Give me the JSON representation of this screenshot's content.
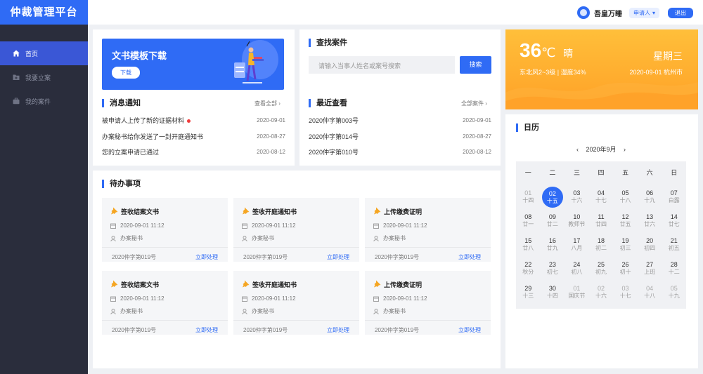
{
  "app": {
    "title": "仲裁管理平台"
  },
  "header": {
    "username": "吾皇万睡",
    "role": "申请人",
    "logout": "退出"
  },
  "sidebar": {
    "items": [
      {
        "label": "首页"
      },
      {
        "label": "我要立案"
      },
      {
        "label": "我的案件"
      }
    ]
  },
  "banner": {
    "title": "文书模板下载",
    "button": "下载"
  },
  "messages": {
    "title": "消息通知",
    "more": "查看全部",
    "items": [
      {
        "text": "被申请人上传了新的证据材料",
        "date": "2020-09-01"
      },
      {
        "text": "办案秘书给你发送了一封开庭通知书",
        "date": "2020-08-27"
      },
      {
        "text": "您的立案申请已通过",
        "date": "2020-08-12"
      }
    ]
  },
  "search": {
    "title": "查找案件",
    "placeholder": "请输入当事人姓名或案号搜索",
    "button": "搜索"
  },
  "recent": {
    "title": "最近查看",
    "more": "全部案件",
    "items": [
      {
        "text": "2020仲字第003号",
        "date": "2020-09-01"
      },
      {
        "text": "2020仲字第014号",
        "date": "2020-08-27"
      },
      {
        "text": "2020仲字第010号",
        "date": "2020-08-12"
      }
    ]
  },
  "weather": {
    "temp": "36",
    "unit": "℃",
    "cond": "晴",
    "desc": "东北风2~3级 | 湿度34%",
    "weekday": "星期三",
    "date": "2020-09-01 杭州市"
  },
  "todo": {
    "title": "待办事项",
    "items": [
      {
        "title": "签收结案文书",
        "time": "2020-09-01 11:12",
        "role": "办案秘书",
        "case": "2020仲字第019号",
        "action": "立即处理"
      },
      {
        "title": "签收开庭通知书",
        "time": "2020-09-01 11:12",
        "role": "办案秘书",
        "case": "2020仲字第019号",
        "action": "立即处理"
      },
      {
        "title": "上传缴费证明",
        "time": "2020-09-01 11:12",
        "role": "办案秘书",
        "case": "2020仲字第019号",
        "action": "立即处理"
      },
      {
        "title": "签收结案文书",
        "time": "2020-09-01 11:12",
        "role": "办案秘书",
        "case": "2020仲字第019号",
        "action": "立即处理"
      },
      {
        "title": "签收开庭通知书",
        "time": "2020-09-01 11:12",
        "role": "办案秘书",
        "case": "2020仲字第019号",
        "action": "立即处理"
      },
      {
        "title": "上传缴费证明",
        "time": "2020-09-01 11:12",
        "role": "办案秘书",
        "case": "2020仲字第019号",
        "action": "立即处理"
      }
    ]
  },
  "calendar": {
    "title": "日历",
    "month": "2020年9月",
    "weekdays": [
      "一",
      "二",
      "三",
      "四",
      "五",
      "六",
      "日"
    ],
    "rows": [
      [
        {
          "d": "01",
          "l": "十四",
          "grey": true
        },
        {
          "d": "02",
          "l": "十五",
          "today": true
        },
        {
          "d": "03",
          "l": "十六"
        },
        {
          "d": "04",
          "l": "十七"
        },
        {
          "d": "05",
          "l": "十八"
        },
        {
          "d": "06",
          "l": "十九"
        },
        {
          "d": "07",
          "l": "白露"
        }
      ],
      [
        {
          "d": "08",
          "l": "廿一"
        },
        {
          "d": "09",
          "l": "廿二"
        },
        {
          "d": "10",
          "l": "教师节"
        },
        {
          "d": "11",
          "l": "廿四"
        },
        {
          "d": "12",
          "l": "廿五"
        },
        {
          "d": "13",
          "l": "廿六"
        },
        {
          "d": "14",
          "l": "廿七"
        }
      ],
      [
        {
          "d": "15",
          "l": "廿八"
        },
        {
          "d": "16",
          "l": "廿九"
        },
        {
          "d": "17",
          "l": "八月"
        },
        {
          "d": "18",
          "l": "初二"
        },
        {
          "d": "19",
          "l": "初三"
        },
        {
          "d": "20",
          "l": "初四"
        },
        {
          "d": "21",
          "l": "初五"
        }
      ],
      [
        {
          "d": "22",
          "l": "秋分"
        },
        {
          "d": "23",
          "l": "初七"
        },
        {
          "d": "24",
          "l": "初八"
        },
        {
          "d": "25",
          "l": "初九"
        },
        {
          "d": "26",
          "l": "初十"
        },
        {
          "d": "27",
          "l": "上班"
        },
        {
          "d": "28",
          "l": "十二"
        }
      ],
      [
        {
          "d": "29",
          "l": "十三"
        },
        {
          "d": "30",
          "l": "十四"
        },
        {
          "d": "01",
          "l": "国庆节",
          "grey": true
        },
        {
          "d": "02",
          "l": "十六",
          "grey": true
        },
        {
          "d": "03",
          "l": "十七",
          "grey": true
        },
        {
          "d": "04",
          "l": "十八",
          "grey": true
        },
        {
          "d": "05",
          "l": "十九",
          "grey": true
        }
      ]
    ]
  }
}
